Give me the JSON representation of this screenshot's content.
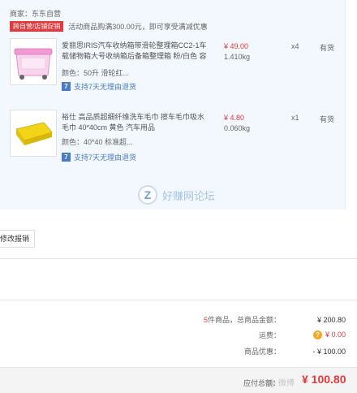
{
  "seller": "商家：东东自营",
  "promo": {
    "tag": "跨自营/店铺促销",
    "text": "活动商品购满300.00元，即可享受满减优惠"
  },
  "items": [
    {
      "name": "爱丽思IRIS汽车收纳箱带滑轮整理箱CC2-1车载储物箱大号收纳箱后备箱整理箱 粉/白色 容",
      "spec": "颜色：50升 滑轮红...",
      "return": "支持7天无理由退货",
      "price": "¥ 49.00",
      "weight": "1.410kg",
      "qty": "x4",
      "stock": "有货"
    },
    {
      "name": "裕仕 高品质超细纤维洗车毛巾 擦车毛巾吸水毛巾 40*40cm 黄色 汽车用品",
      "spec": "颜色：40*40 标准超...",
      "return": "支持7天无理由退货",
      "price": "¥ 4.80",
      "weight": "0.060kg",
      "qty": "x1",
      "stock": "有货"
    }
  ],
  "watermark": "好赚网论坛",
  "invoice_button": "修改报销",
  "summary": {
    "count_num": "5",
    "count_label": "件商品，总商品金额：",
    "total": "¥ 200.80",
    "freight_label": "运费：",
    "freight": "¥ 0.00",
    "discount_label": "商品优惠：",
    "discount": "- ¥ 100.00"
  },
  "footer": {
    "pay_label": "应付总额：",
    "pay_amount": "¥ 100.80",
    "weibo": "@ 微博"
  },
  "colors": {
    "accent_red": "#e4393c",
    "link_blue": "#4a7bc5",
    "panel_bg": "#f3f8fe"
  }
}
